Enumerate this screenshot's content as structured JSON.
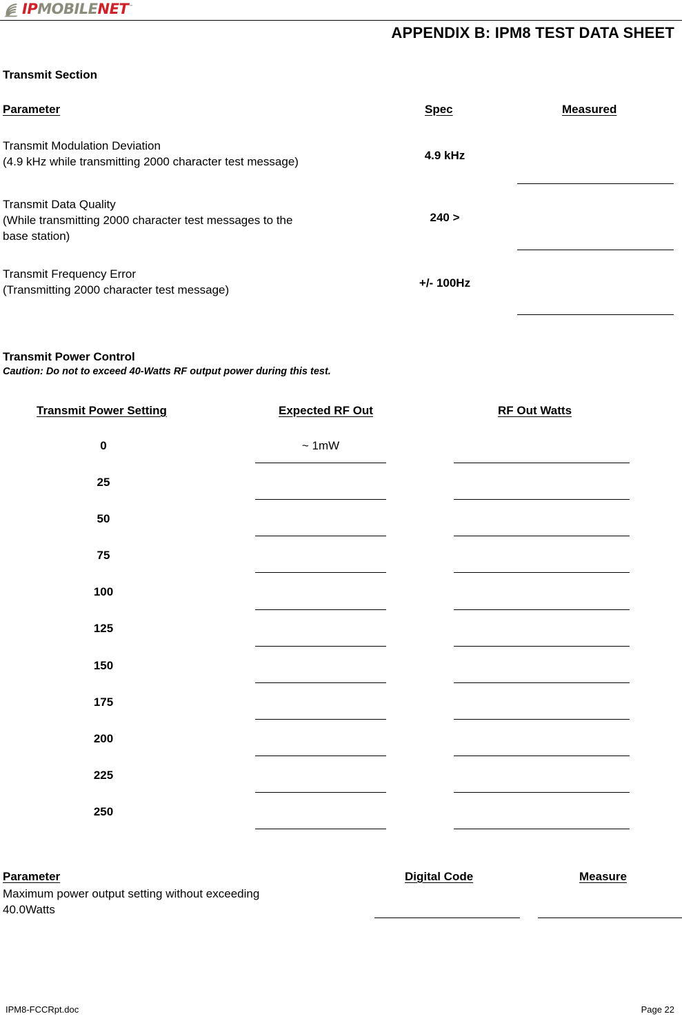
{
  "header": {
    "logo": {
      "icon": "signal-wave-icon",
      "part_ip": "IP",
      "part_mobile": "MOBILE",
      "part_net": "NET",
      "trademark": "™",
      "color_red": "#CC2229",
      "color_gray": "#8C8C7D"
    },
    "title": "APPENDIX B:  IPM8 TEST DATA SHEET"
  },
  "transmit_section": {
    "heading": "Transmit Section",
    "columns": {
      "parameter": "Parameter",
      "spec": "Spec",
      "measured": "Measured"
    },
    "rows": [
      {
        "name": "Transmit Modulation Deviation",
        "detail": "(4.9 kHz while transmitting 2000 character test message)",
        "detail2": "",
        "spec": "4.9 kHz",
        "measured": ""
      },
      {
        "name": "Transmit Data Quality",
        "detail": "(While transmitting 2000 character test messages to the",
        "detail2": "base station)",
        "spec": "240 >",
        "measured": ""
      },
      {
        "name": "Transmit Frequency Error",
        "detail": "(Transmitting 2000 character test message)",
        "detail2": "",
        "spec": "+/- 100Hz",
        "measured": ""
      }
    ]
  },
  "power_control": {
    "heading": "Transmit Power Control",
    "caution": "Caution: Do not to exceed 40-Watts RF output power during this test.",
    "columns": {
      "setting": "Transmit Power Setting",
      "expected": "Expected RF Out",
      "watts": "RF Out Watts"
    },
    "rows": [
      {
        "setting": "0",
        "expected": "~ 1mW",
        "watts": ""
      },
      {
        "setting": "25",
        "expected": "",
        "watts": ""
      },
      {
        "setting": "50",
        "expected": "",
        "watts": ""
      },
      {
        "setting": "75",
        "expected": "",
        "watts": ""
      },
      {
        "setting": "100",
        "expected": "",
        "watts": ""
      },
      {
        "setting": "125",
        "expected": "",
        "watts": ""
      },
      {
        "setting": "150",
        "expected": "",
        "watts": ""
      },
      {
        "setting": "175",
        "expected": "",
        "watts": ""
      },
      {
        "setting": "200",
        "expected": "",
        "watts": ""
      },
      {
        "setting": "225",
        "expected": "",
        "watts": ""
      },
      {
        "setting": "250",
        "expected": "",
        "watts": ""
      }
    ]
  },
  "max_power_section": {
    "columns": {
      "parameter": "Parameter",
      "digital_code": "Digital Code",
      "measure": "Measure"
    },
    "description_line1": "Maximum power output setting without exceeding",
    "description_line2": "40.0Watts",
    "digital_code_value": "",
    "measure_value": ""
  },
  "footer": {
    "file": "IPM8-FCCRpt.doc",
    "page": "Page 22"
  }
}
